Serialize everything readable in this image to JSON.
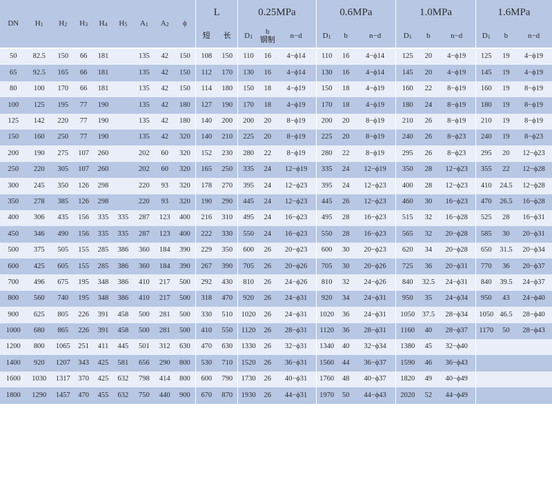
{
  "header": {
    "DN": "DN",
    "H1": "H1",
    "H2": "H2",
    "H3": "H3",
    "H4": "H4",
    "H5": "H5",
    "A1": "A1",
    "A2": "A2",
    "phi": "ϕ",
    "L": "L",
    "L_short": "短",
    "L_long": "长",
    "p025": "0.25MPa",
    "p06": "0.6MPa",
    "p10": "1.0MPa",
    "p16": "1.6MPa",
    "D1": "D1",
    "b": "b",
    "b_note": "钢制",
    "nd": "n−d"
  },
  "rows": [
    [
      "50",
      "82.5",
      "150",
      "66",
      "181",
      "",
      "135",
      "42",
      "150",
      "108",
      "150",
      "110",
      "16",
      "4−ϕ14",
      "110",
      "16",
      "4−ϕ14",
      "125",
      "20",
      "4−ϕ19",
      "125",
      "19",
      "4−ϕ19"
    ],
    [
      "65",
      "92.5",
      "165",
      "66",
      "181",
      "",
      "135",
      "42",
      "150",
      "112",
      "170",
      "130",
      "16",
      "4−ϕ14",
      "130",
      "16",
      "4−ϕ14",
      "145",
      "20",
      "4−ϕ19",
      "145",
      "19",
      "4−ϕ19"
    ],
    [
      "80",
      "100",
      "170",
      "66",
      "181",
      "",
      "135",
      "42",
      "150",
      "114",
      "180",
      "150",
      "18",
      "4−ϕ19",
      "150",
      "18",
      "4−ϕ19",
      "160",
      "22",
      "8−ϕ19",
      "160",
      "19",
      "8−ϕ19"
    ],
    [
      "100",
      "125",
      "195",
      "77",
      "190",
      "",
      "135",
      "42",
      "180",
      "127",
      "190",
      "170",
      "18",
      "4−ϕ19",
      "170",
      "18",
      "4−ϕ19",
      "180",
      "24",
      "8−ϕ19",
      "180",
      "19",
      "8−ϕ19"
    ],
    [
      "125",
      "142",
      "220",
      "77",
      "190",
      "",
      "135",
      "42",
      "180",
      "140",
      "200",
      "200",
      "20",
      "8−ϕ19",
      "200",
      "20",
      "8−ϕ19",
      "210",
      "26",
      "8−ϕ19",
      "210",
      "19",
      "8−ϕ19"
    ],
    [
      "150",
      "160",
      "250",
      "77",
      "190",
      "",
      "135",
      "42",
      "320",
      "140",
      "210",
      "225",
      "20",
      "8−ϕ19",
      "225",
      "20",
      "8−ϕ19",
      "240",
      "26",
      "8−ϕ23",
      "240",
      "19",
      "8−ϕ23"
    ],
    [
      "200",
      "190",
      "275",
      "107",
      "260",
      "",
      "202",
      "60",
      "320",
      "152",
      "230",
      "280",
      "22",
      "8−ϕ19",
      "280",
      "22",
      "8−ϕ19",
      "295",
      "26",
      "8−ϕ23",
      "295",
      "20",
      "12−ϕ23"
    ],
    [
      "250",
      "220",
      "305",
      "107",
      "260",
      "",
      "202",
      "60",
      "320",
      "165",
      "250",
      "335",
      "24",
      "12−ϕ19",
      "335",
      "24",
      "12−ϕ19",
      "350",
      "28",
      "12−ϕ23",
      "355",
      "22",
      "12−ϕ28"
    ],
    [
      "300",
      "245",
      "350",
      "126",
      "298",
      "",
      "220",
      "93",
      "320",
      "178",
      "270",
      "395",
      "24",
      "12−ϕ23",
      "395",
      "24",
      "12−ϕ23",
      "400",
      "28",
      "12−ϕ23",
      "410",
      "24.5",
      "12−ϕ28"
    ],
    [
      "350",
      "278",
      "385",
      "126",
      "298",
      "",
      "220",
      "93",
      "320",
      "190",
      "290",
      "445",
      "24",
      "12−ϕ23",
      "445",
      "26",
      "12−ϕ23",
      "460",
      "30",
      "16−ϕ23",
      "470",
      "26.5",
      "16−ϕ28"
    ],
    [
      "400",
      "306",
      "435",
      "156",
      "335",
      "335",
      "287",
      "123",
      "400",
      "216",
      "310",
      "495",
      "24",
      "16−ϕ23",
      "495",
      "28",
      "16−ϕ23",
      "515",
      "32",
      "16−ϕ28",
      "525",
      "28",
      "16−ϕ31"
    ],
    [
      "450",
      "346",
      "490",
      "156",
      "335",
      "335",
      "287",
      "123",
      "400",
      "222",
      "330",
      "550",
      "24",
      "16−ϕ23",
      "550",
      "28",
      "16−ϕ23",
      "565",
      "32",
      "20−ϕ28",
      "585",
      "30",
      "20−ϕ31"
    ],
    [
      "500",
      "375",
      "505",
      "155",
      "285",
      "386",
      "360",
      "184",
      "390",
      "229",
      "350",
      "600",
      "26",
      "20−ϕ23",
      "600",
      "30",
      "20−ϕ23",
      "620",
      "34",
      "20−ϕ28",
      "650",
      "31.5",
      "20−ϕ34"
    ],
    [
      "600",
      "425",
      "605",
      "155",
      "285",
      "386",
      "360",
      "184",
      "390",
      "267",
      "390",
      "705",
      "26",
      "20−ϕ26",
      "705",
      "30",
      "20−ϕ26",
      "725",
      "36",
      "20−ϕ31",
      "770",
      "36",
      "20−ϕ37"
    ],
    [
      "700",
      "496",
      "675",
      "195",
      "348",
      "386",
      "410",
      "217",
      "500",
      "292",
      "430",
      "810",
      "26",
      "24−ϕ26",
      "810",
      "32",
      "24−ϕ26",
      "840",
      "32.5",
      "24−ϕ31",
      "840",
      "39.5",
      "24−ϕ37"
    ],
    [
      "800",
      "560",
      "740",
      "195",
      "348",
      "386",
      "410",
      "217",
      "500",
      "318",
      "470",
      "920",
      "26",
      "24−ϕ31",
      "920",
      "34",
      "24−ϕ31",
      "950",
      "35",
      "24−ϕ34",
      "950",
      "43",
      "24−ϕ40"
    ],
    [
      "900",
      "625",
      "805",
      "226",
      "391",
      "458",
      "500",
      "281",
      "500",
      "330",
      "510",
      "1020",
      "26",
      "24−ϕ31",
      "1020",
      "36",
      "24−ϕ31",
      "1050",
      "37.5",
      "28−ϕ34",
      "1050",
      "46.5",
      "28−ϕ40"
    ],
    [
      "1000",
      "680",
      "865",
      "226",
      "391",
      "458",
      "500",
      "281",
      "500",
      "410",
      "550",
      "1120",
      "26",
      "28−ϕ31",
      "1120",
      "36",
      "28−ϕ31",
      "1160",
      "40",
      "28−ϕ37",
      "1170",
      "50",
      "28−ϕ43"
    ],
    [
      "1200",
      "800",
      "1065",
      "251",
      "411",
      "445",
      "501",
      "312",
      "630",
      "470",
      "630",
      "1330",
      "26",
      "32−ϕ31",
      "1340",
      "40",
      "32−ϕ34",
      "1380",
      "45",
      "32−ϕ40",
      "",
      "",
      ""
    ],
    [
      "1400",
      "920",
      "1207",
      "343",
      "425",
      "581",
      "656",
      "290",
      "800",
      "530",
      "710",
      "1520",
      "26",
      "36−ϕ31",
      "1560",
      "44",
      "36−ϕ37",
      "1590",
      "46",
      "36−ϕ43",
      "",
      "",
      ""
    ],
    [
      "1600",
      "1030",
      "1317",
      "370",
      "425",
      "632",
      "798",
      "414",
      "800",
      "600",
      "790",
      "1730",
      "26",
      "40−ϕ31",
      "1760",
      "48",
      "40−ϕ37",
      "1820",
      "49",
      "40−ϕ49",
      "",
      "",
      ""
    ],
    [
      "1800",
      "1290",
      "1457",
      "470",
      "455",
      "632",
      "750",
      "440",
      "900",
      "670",
      "870",
      "1930",
      "26",
      "44−ϕ31",
      "1970",
      "50",
      "44−ϕ43",
      "2020",
      "52",
      "44−ϕ49",
      "",
      "",
      ""
    ]
  ]
}
